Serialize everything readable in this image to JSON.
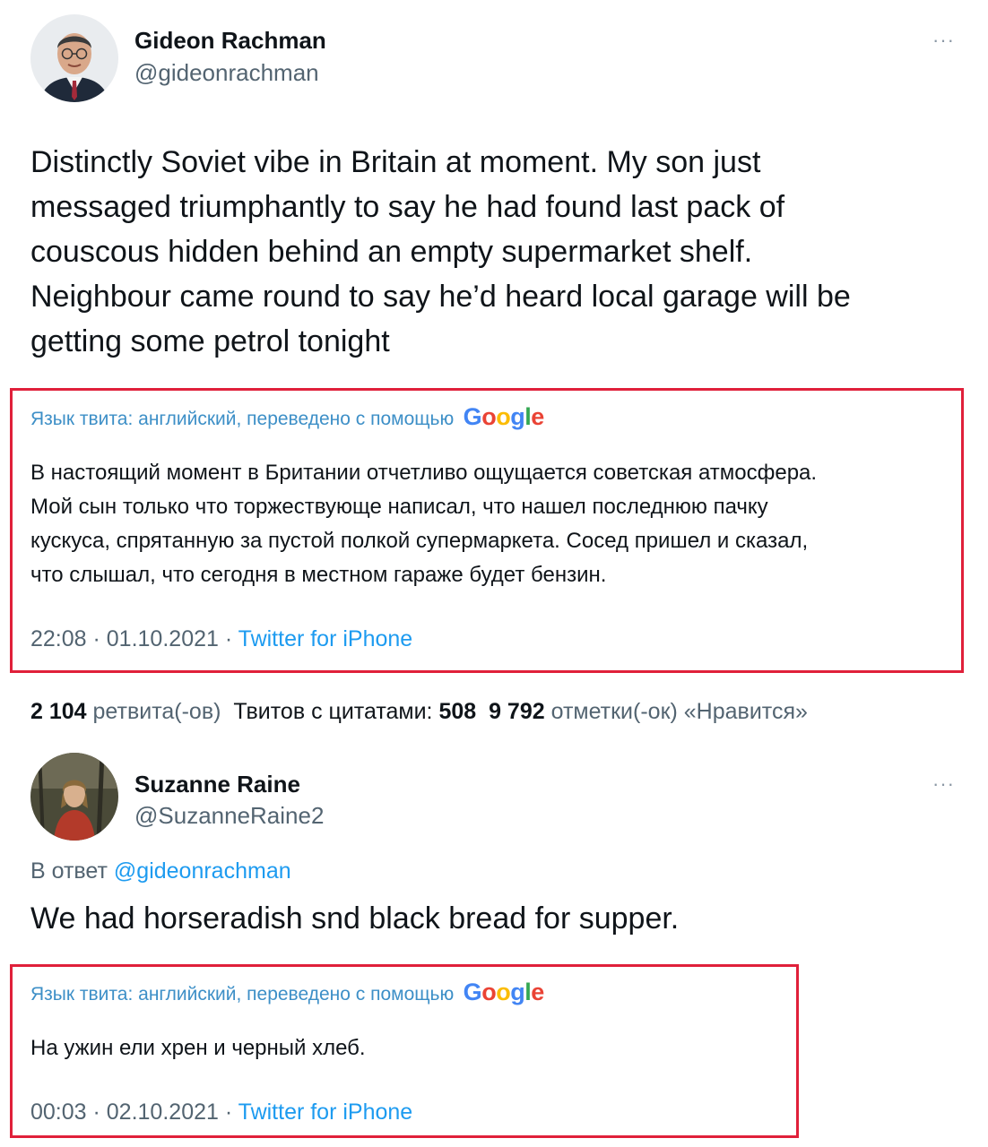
{
  "tweet1": {
    "author_name": "Gideon Rachman",
    "author_handle": "@gideonrachman",
    "more_label": "···",
    "text_lines": [
      "Distinctly Soviet vibe in Britain at moment. My son just",
      "messaged triumphantly to say he had found last pack of",
      "couscous hidden behind an empty supermarket shelf.",
      "Neighbour came round to say he’d heard local garage will be",
      "getting some petrol tonight"
    ],
    "translation_label": "Язык твита: английский, переведено с помощью",
    "translation_lines": [
      "В настоящий момент в Британии отчетливо ощущается советская атмосфера.",
      "Мой сын только что торжествующе написал, что нашел последнюю пачку",
      "кускуса, спрятанную за пустой полкой супермаркета. Сосед пришел и сказал,",
      "что слышал, что сегодня в местном гараже будет бензин."
    ],
    "time": "22:08 · 01.10.2021 · ",
    "source": "Twitter for iPhone"
  },
  "stats": {
    "retweets_count": "2 104",
    "retweets_label": "ретвита(-ов)",
    "quotes_label": "Твитов с цитатами:",
    "quotes_count": "508",
    "likes_count": "9 792",
    "likes_label": "отметки(-ок) «Нравится»"
  },
  "tweet2": {
    "author_name": "Suzanne Raine",
    "author_handle": "@SuzanneRaine2",
    "more_label": "···",
    "reply_prefix": "В ответ",
    "reply_handle": "@gideonrachman",
    "text": "We had horseradish snd black bread for supper.",
    "translation_label": "Язык твита: английский, переведено с помощью",
    "translation_text": "На ужин ели хрен и черный хлеб.",
    "time": "00:03 · 02.10.2021 · ",
    "source": "Twitter for iPhone"
  },
  "google": {
    "letters": [
      "G",
      "o",
      "o",
      "g",
      "l",
      "e"
    ],
    "colors": [
      "#4285F4",
      "#EA4335",
      "#FBBC05",
      "#4285F4",
      "#34A853",
      "#EA4335"
    ]
  },
  "colors": {
    "highlight_box": "#e0203a",
    "link": "#1d9bf0",
    "secondary_text": "#536471"
  }
}
